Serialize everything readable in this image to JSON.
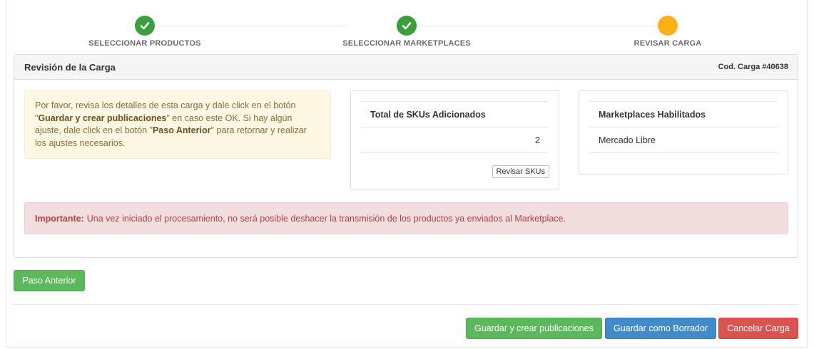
{
  "stepper": {
    "steps": [
      {
        "label": "SELECCIONAR PRODUCTOS",
        "state": "done",
        "icon": "check-icon"
      },
      {
        "label": "SELECCIONAR MARKETPLACES",
        "state": "done",
        "icon": "check-icon"
      },
      {
        "label": "REVISAR CARGA",
        "state": "active",
        "icon": "circle"
      }
    ],
    "colors": {
      "done": "#3a9e3a",
      "active": "#fbb116"
    }
  },
  "panel": {
    "title": "Revisión de la Carga",
    "code": "Cod. Carga #40638",
    "info": {
      "part1": "Por favor, revisa los detalles de esta carga y dale click en el botón \"",
      "bold1": "Guardar y crear publicaciones",
      "part2": "\" en caso este OK. Si hay algún ajuste, dale click en el botón \"",
      "bold2": "Paso Anterior",
      "part3": "\" para retornar y realizar los ajustes necesarios."
    },
    "skus_card": {
      "header": "Total de SKUs Adicionados",
      "value": "2",
      "button": "Revisar SKUs"
    },
    "marketplaces_card": {
      "header": "Marketplaces Habilitados",
      "items": [
        "Mercado Libre"
      ]
    },
    "alert": {
      "strong": "Importante:",
      "text": "Una vez iniciado el procesamiento, no será posible deshacer la transmisión de los productos ya enviados al Marketplace."
    }
  },
  "actions": {
    "previous": "Paso Anterior",
    "save_create": "Guardar y crear publicaciones",
    "save_draft": "Guardar como Borrador",
    "cancel": "Cancelar Carga"
  },
  "colors": {
    "success": "#5cb85c",
    "primary": "#428bca",
    "danger": "#d9534f",
    "warning_bg": "#fcf8e3",
    "danger_bg": "#f2dede"
  }
}
